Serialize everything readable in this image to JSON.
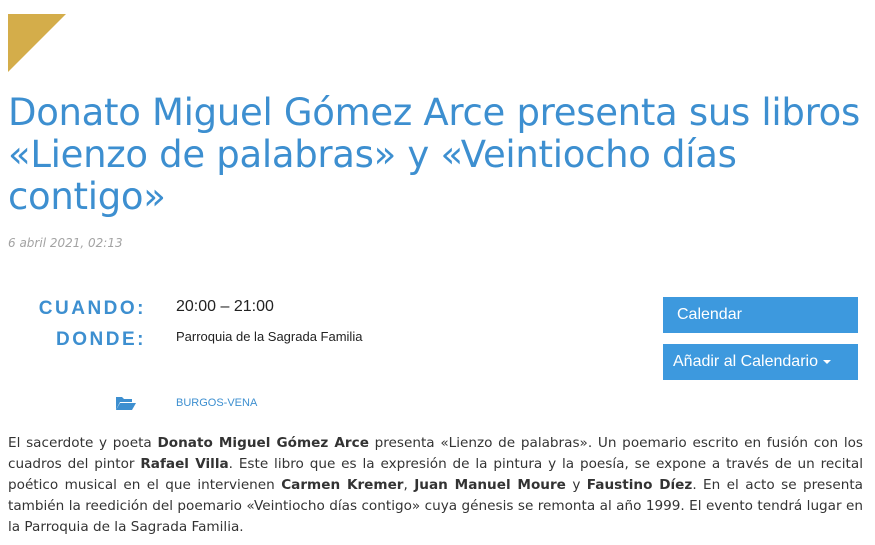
{
  "article": {
    "title": "Donato Miguel Gómez Arce presenta sus libros «Lienzo de palabras» y «Veintiocho días contigo»",
    "date": "6 abril 2021, 02:13"
  },
  "event": {
    "when_label": "CUANDO:",
    "when_value": "20:00 – 21:00",
    "where_label": "DONDE:",
    "where_value": "Parroquia de la Sagrada Familia",
    "calendar_button": "Calendar",
    "add_calendar_button": "Añadir al Calendario",
    "category": "BURGOS-VENA"
  },
  "body": {
    "p1": "El sacerdote y poeta ",
    "b1": "Donato Miguel Gómez Arce",
    "p2": " presenta «Lienzo de palabras». Un poemario escrito en fusión con los cuadros del pintor ",
    "b2": "Rafael Villa",
    "p3": ". Este libro que es la expresión de la pintura y la poesía, se expone a través de un recital poético musical en el que intervienen ",
    "b3": "Carmen Kremer",
    "p4": ", ",
    "b4": "Juan Manuel Moure",
    "p5": " y ",
    "b5": "Faustino Díez",
    "p6": ". En el acto se presenta también la reedición del poemario «Veintiocho días contigo» cuya génesis se remonta al año 1999. El evento tendrá lugar en la Parroquia de la Sagrada Familia."
  },
  "colors": {
    "accent": "#3d8fd0",
    "button": "#3d99de",
    "corner": "#d4ad4a",
    "date": "#a3a3a3"
  },
  "icons": {
    "corner": "corner-triangle-icon",
    "category": "folder-open-icon",
    "dropdown": "caret-down-icon"
  }
}
